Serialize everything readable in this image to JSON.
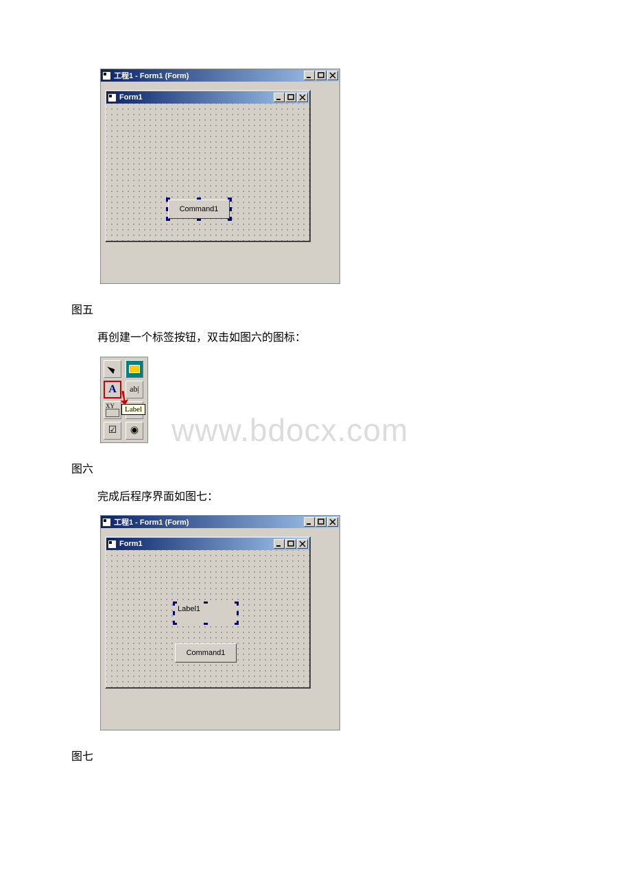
{
  "watermark": "www.bdocx.com",
  "fig5": {
    "outer_title": "工程1 - Form1 (Form)",
    "form_title": "Form1",
    "command_label": "Command1",
    "caption": "图五"
  },
  "para1": "再创建一个标签按钮，双击如图六的图标：",
  "fig6": {
    "label_glyph": "A",
    "tooltip": "Label",
    "caption": "图六"
  },
  "para2": "完成后程序界面如图七：",
  "fig7": {
    "outer_title": "工程1 - Form1 (Form)",
    "form_title": "Form1",
    "label_text": "Label1",
    "command_label": "Command1",
    "caption": "图七"
  },
  "win_btns": {
    "min": "_",
    "max": "□",
    "close": "×"
  }
}
